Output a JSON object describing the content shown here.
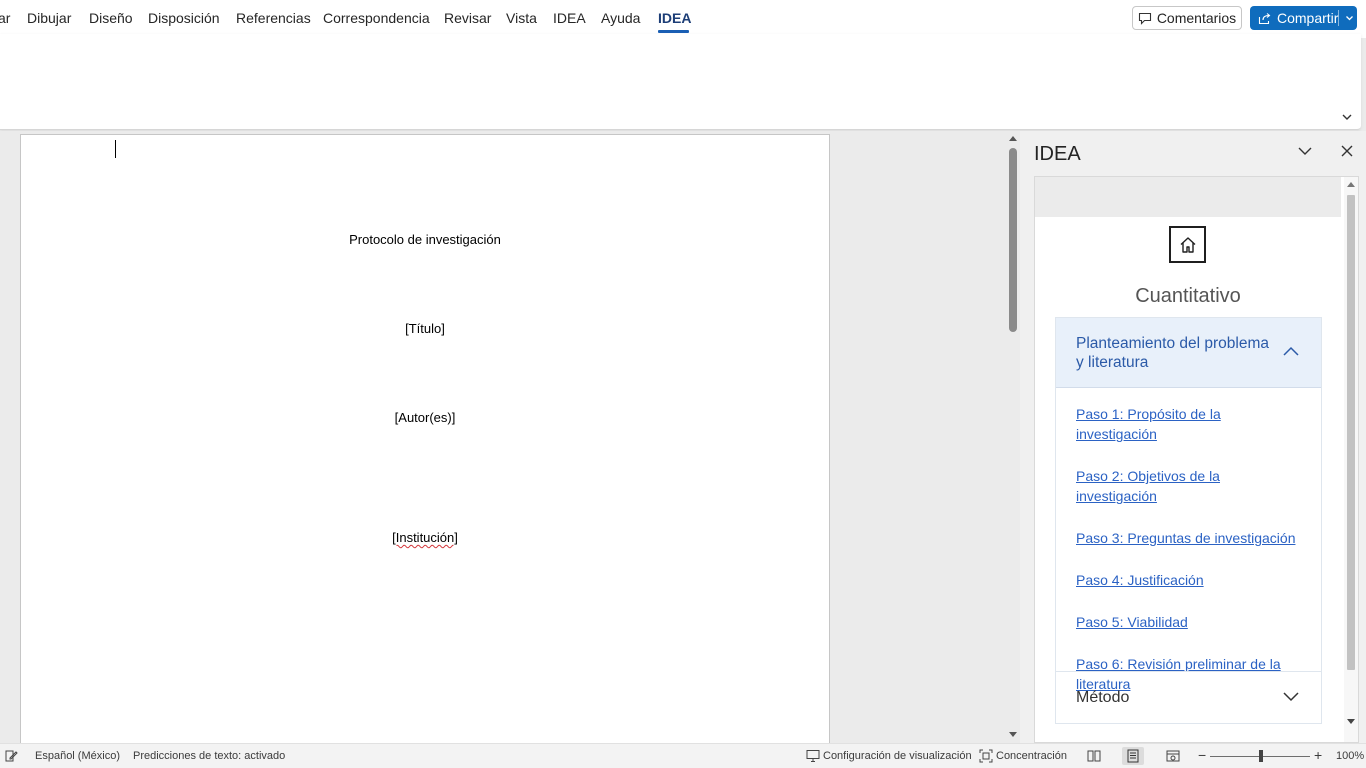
{
  "menubar": {
    "tabs": [
      "ar",
      "Dibujar",
      "Diseño",
      "Disposición",
      "Referencias",
      "Correspondencia",
      "Revisar",
      "Vista",
      "IDEA",
      "Ayuda",
      "IDEA"
    ],
    "active_tab": "IDEA",
    "comments_label": "Comentarios",
    "share_label": "Compartir"
  },
  "document": {
    "lines": [
      "Protocolo de investigación",
      "[Título]",
      "[Autor(es)]",
      "[Institución]"
    ]
  },
  "pane": {
    "title": "IDEA",
    "section_title": "Cuantitativo",
    "accordion_title": "Planteamiento del problema y literatura",
    "steps": [
      "Paso 1: Propósito de la investigación",
      "Paso 2: Objetivos de la investigación",
      "Paso 3: Preguntas de investigación",
      "Paso 4: Justificación",
      "Paso 5: Viabilidad",
      "Paso 6: Revisión preliminar de la literatura"
    ],
    "next_section": "Método"
  },
  "statusbar": {
    "language": "Español (México)",
    "predictions": "Predicciones de texto: activado",
    "display_settings": "Configuración de visualización",
    "focus": "Concentración",
    "zoom": "100%"
  },
  "colors": {
    "accent": "#0f6cbd",
    "link": "#2b62c4",
    "accordion_bg": "#e8f0fa"
  }
}
